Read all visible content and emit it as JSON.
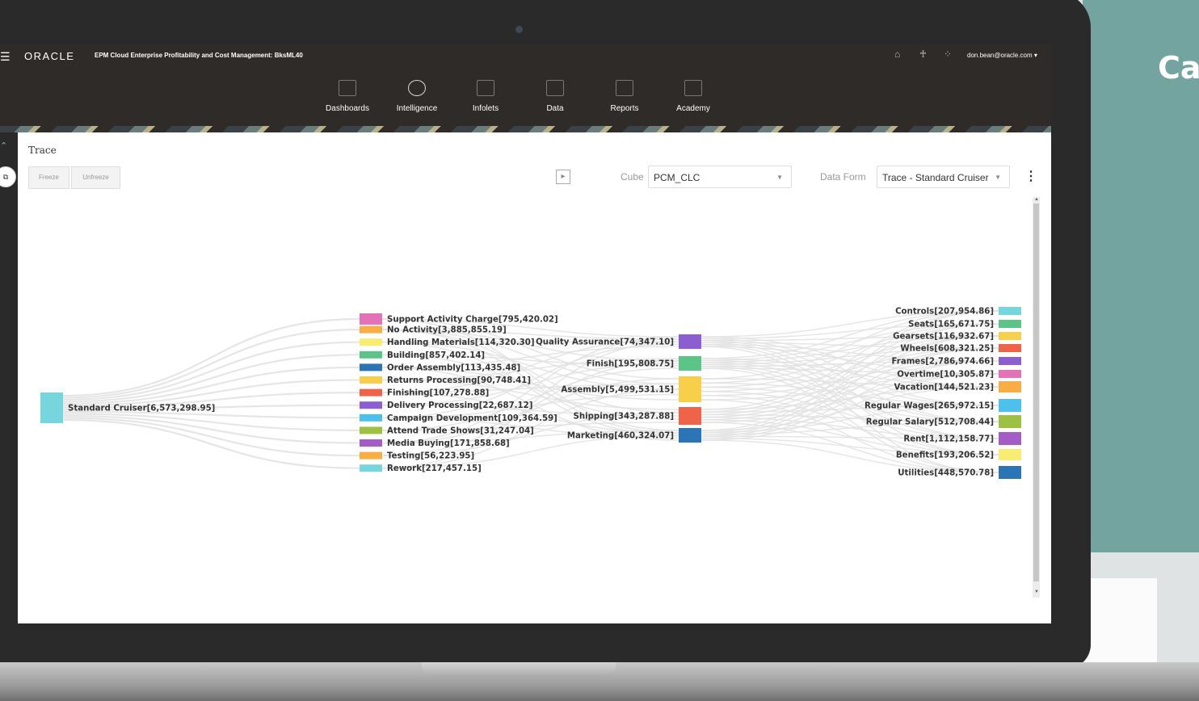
{
  "banner_text": "Ca",
  "header": {
    "logo": "ORACLE",
    "app_title": "EPM Cloud Enterprise Profitability and Cost Management: BksML40",
    "user": "don.bean@oracle.com ▾"
  },
  "nav": [
    {
      "label": "Dashboards",
      "icon": "dashboard-icon"
    },
    {
      "label": "Intelligence",
      "icon": "intelligence-icon"
    },
    {
      "label": "Infolets",
      "icon": "infolets-icon"
    },
    {
      "label": "Data",
      "icon": "data-icon"
    },
    {
      "label": "Reports",
      "icon": "reports-icon"
    },
    {
      "label": "Academy",
      "icon": "academy-icon"
    }
  ],
  "page": {
    "title": "Trace",
    "freeze_label": "Freeze",
    "unfreeze_label": "Unfreeze",
    "cube_label": "Cube",
    "cube_value": "PCM_CLC",
    "form_label": "Data Form",
    "form_value": "Trace - Standard Cruiser"
  },
  "colors": {
    "header_bg": "#2e2b28",
    "link": "#e2e2e2"
  },
  "chart_data": {
    "type": "sankey",
    "columns": [
      [
        {
          "name": "Standard Cruiser",
          "value": "6,573,298.95",
          "color": "#75d7dd"
        }
      ],
      [
        {
          "name": "Support Activity Charge",
          "value": "795,420.02",
          "color": "#e373b6"
        },
        {
          "name": "No Activity",
          "value": "3,885,855.19",
          "color": "#f9ad45"
        },
        {
          "name": "Handling Materials",
          "value": "114,320.30",
          "color": "#f8ec73"
        },
        {
          "name": "Building",
          "value": "857,402.14",
          "color": "#5cc486"
        },
        {
          "name": "Order Assembly",
          "value": "113,435.48",
          "color": "#2b75b7"
        },
        {
          "name": "Returns Processing",
          "value": "90,748.41",
          "color": "#f8cf4a"
        },
        {
          "name": "Finishing",
          "value": "107,278.88",
          "color": "#ef6449"
        },
        {
          "name": "Delivery Processing",
          "value": "22,687.12",
          "color": "#8b5fcf"
        },
        {
          "name": "Campaign Development",
          "value": "109,364.59",
          "color": "#4dc0eb"
        },
        {
          "name": "Attend Trade Shows",
          "value": "31,247.04",
          "color": "#9dc143"
        },
        {
          "name": "Media Buying",
          "value": "171,858.68",
          "color": "#a45cc6"
        },
        {
          "name": "Testing",
          "value": "56,223.95",
          "color": "#f9ad45"
        },
        {
          "name": "Rework",
          "value": "217,457.15",
          "color": "#75d7dd"
        }
      ],
      [
        {
          "name": "Quality Assurance",
          "value": "74,347.10",
          "color": "#8b5fcf"
        },
        {
          "name": "Finish",
          "value": "195,808.75",
          "color": "#5cc486"
        },
        {
          "name": "Assembly",
          "value": "5,499,531.15",
          "color": "#f8cf4a"
        },
        {
          "name": "Shipping",
          "value": "343,287.88",
          "color": "#ef6449"
        },
        {
          "name": "Marketing",
          "value": "460,324.07",
          "color": "#2b75b7"
        }
      ],
      [
        {
          "name": "Controls",
          "value": "207,954.86",
          "color": "#75d7dd"
        },
        {
          "name": "Seats",
          "value": "165,671.75",
          "color": "#5cc486"
        },
        {
          "name": "Gearsets",
          "value": "116,932.67",
          "color": "#f8cf4a"
        },
        {
          "name": "Wheels",
          "value": "608,321.25",
          "color": "#ef6449"
        },
        {
          "name": "Frames",
          "value": "2,786,974.66",
          "color": "#8b5fcf"
        },
        {
          "name": "Overtime",
          "value": "10,305.87",
          "color": "#e373b6"
        },
        {
          "name": "Vacation",
          "value": "144,521.23",
          "color": "#f9ad45"
        },
        {
          "name": "Regular Wages",
          "value": "265,972.15",
          "color": "#4dc0eb"
        },
        {
          "name": "Regular Salary",
          "value": "512,708.44",
          "color": "#9dc143"
        },
        {
          "name": "Rent",
          "value": "1,112,158.77",
          "color": "#a45cc6"
        },
        {
          "name": "Benefits",
          "value": "193,206.52",
          "color": "#f8ec73"
        },
        {
          "name": "Utilities",
          "value": "448,570.78",
          "color": "#2b75b7"
        }
      ]
    ]
  }
}
